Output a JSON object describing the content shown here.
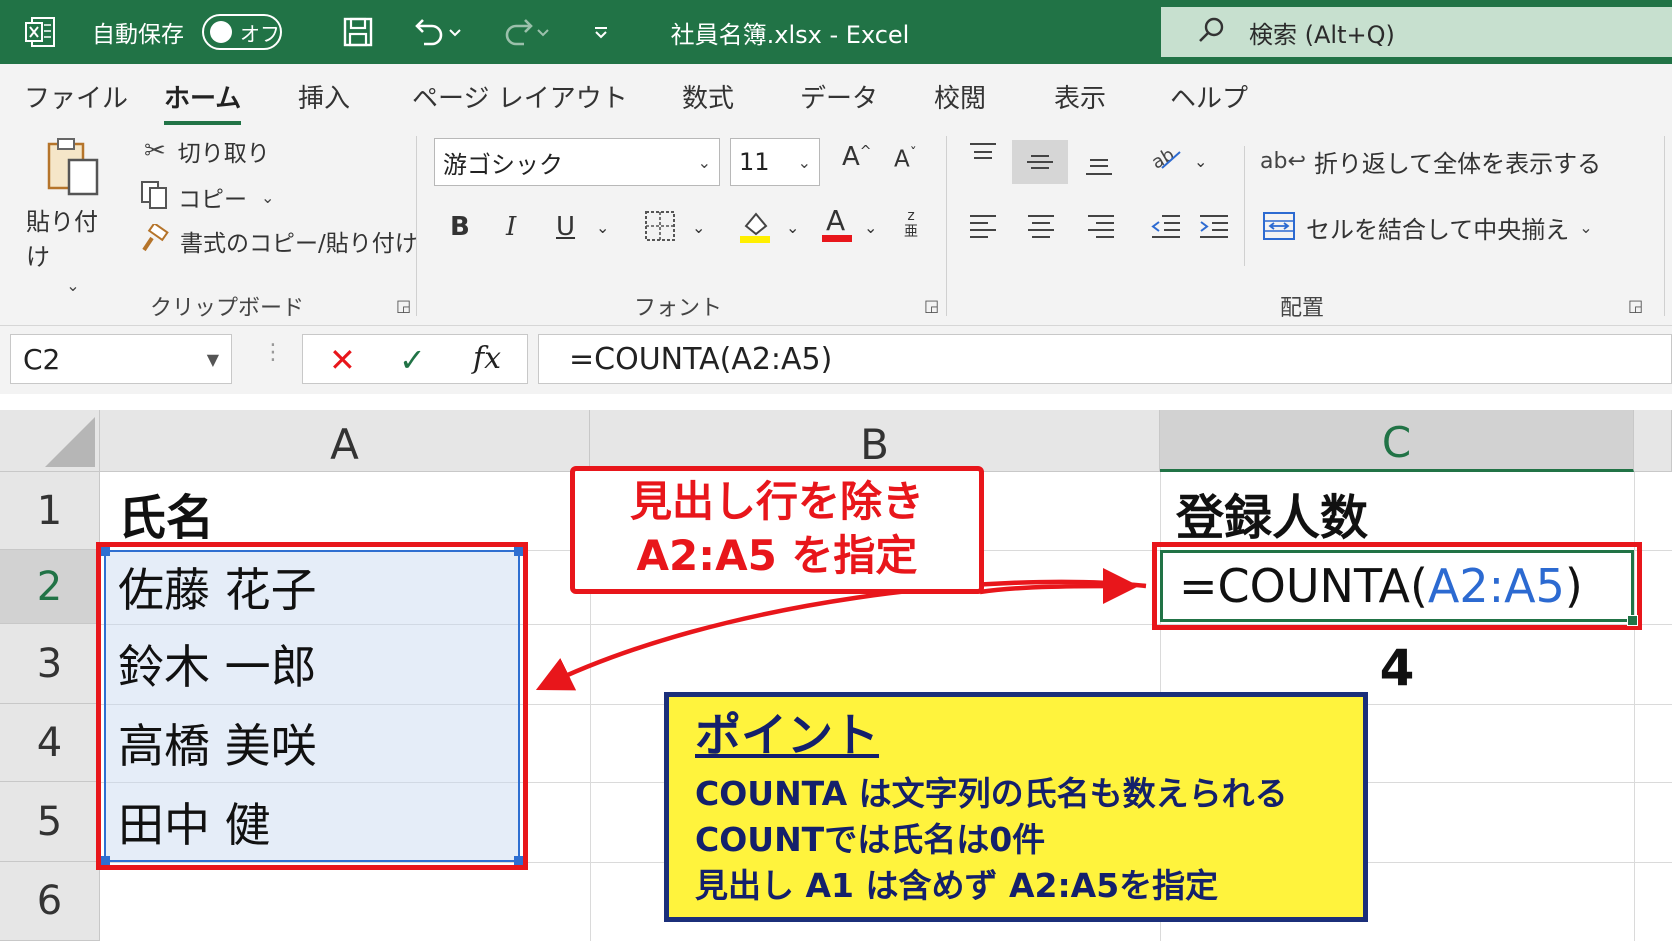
{
  "titlebar": {
    "autosave_label": "自動保存",
    "autosave_state": "オフ",
    "doc_title": "社員名簿.xlsx  -  Excel",
    "search_placeholder": "検索 (Alt+Q)",
    "bg_color": "#217346"
  },
  "tabs": [
    "ファイル",
    "ホーム",
    "挿入",
    "ページ レイアウト",
    "数式",
    "データ",
    "校閲",
    "表示",
    "ヘルプ"
  ],
  "active_tab": "ホーム",
  "ribbon": {
    "clipboard": {
      "paste": "貼り付け",
      "cut": "切り取り",
      "copy": "コピー",
      "format_painter": "書式のコピー/貼り付け",
      "label": "クリップボード"
    },
    "font": {
      "font_name": "游ゴシック",
      "font_size": "11",
      "label": "フォント"
    },
    "alignment": {
      "wrap_text": "折り返して全体を表示する",
      "merge_center": "セルを結合して中央揃え",
      "label": "配置"
    }
  },
  "formula_bar": {
    "name_box": "C2",
    "formula": "=COUNTA(A2:A5)"
  },
  "sheet": {
    "columns": [
      "A",
      "B",
      "C"
    ],
    "selected_column": "C",
    "rows": [
      "1",
      "2",
      "3",
      "4",
      "5",
      "6"
    ],
    "selected_row": "2",
    "a1": "氏名",
    "names": [
      "佐藤 花子",
      "鈴木 一郎",
      "高橋 美咲",
      "田中 健"
    ],
    "c1": "登録人数",
    "c2_prefix": "=COUNTA(",
    "c2_ref": "A2:A5",
    "c2_suffix": ")",
    "c3": "4"
  },
  "callout": {
    "line1": "見出し行を除き",
    "line2": "A2:A5 を指定"
  },
  "point_box": {
    "title": "ポイント",
    "lines": [
      "COUNTA は文字列の氏名も数えられる",
      "COUNTでは氏名は0件",
      "見出し A1 は含めず A2:A5を指定"
    ]
  },
  "colors": {
    "excel_green": "#217346",
    "annotation_red": "#e8161b",
    "point_bg": "#fff33d",
    "point_border": "#1b2f7a",
    "range_blue": "#2f6fd1"
  }
}
